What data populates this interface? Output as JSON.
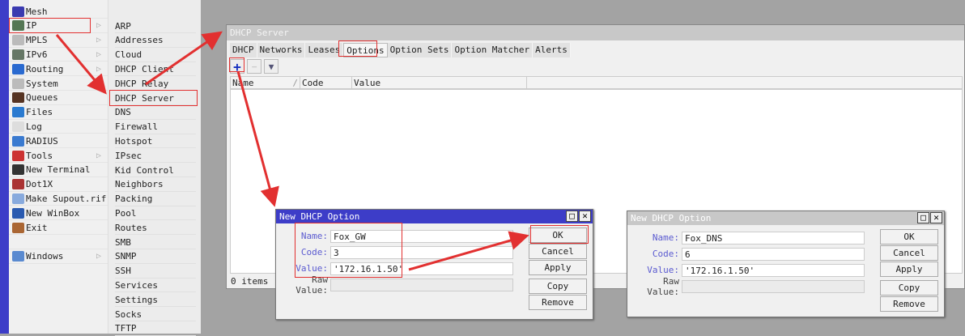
{
  "menu": [
    {
      "label": "Mesh",
      "color": "#3a3ab0",
      "sub": false
    },
    {
      "label": "IP",
      "color": "#557755",
      "sub": true
    },
    {
      "label": "MPLS",
      "color": "#bbbbbb",
      "sub": true
    },
    {
      "label": "IPv6",
      "color": "#667766",
      "sub": true
    },
    {
      "label": "Routing",
      "color": "#2a6ad0",
      "sub": true
    },
    {
      "label": "System",
      "color": "#bbbbbb",
      "sub": true
    },
    {
      "label": "Queues",
      "color": "#553322",
      "sub": false
    },
    {
      "label": "Files",
      "color": "#2a7ad0",
      "sub": false
    },
    {
      "label": "Log",
      "color": "#dddddd",
      "sub": false
    },
    {
      "label": "RADIUS",
      "color": "#3a7ad0",
      "sub": false
    },
    {
      "label": "Tools",
      "color": "#cc3333",
      "sub": true
    },
    {
      "label": "New Terminal",
      "color": "#333333",
      "sub": false
    },
    {
      "label": "Dot1X",
      "color": "#aa3333",
      "sub": false
    },
    {
      "label": "Make Supout.rif",
      "color": "#88aadd",
      "sub": false
    },
    {
      "label": "New WinBox",
      "color": "#2a5ab0",
      "sub": false
    },
    {
      "label": "Exit",
      "color": "#aa6633",
      "sub": false
    },
    {
      "label": "",
      "color": "",
      "sub": false
    },
    {
      "label": "Windows",
      "color": "#5a8ad0",
      "sub": true
    }
  ],
  "ip_submenu": [
    "ARP",
    "Addresses",
    "Cloud",
    "DHCP Client",
    "DHCP Relay",
    "DHCP Server",
    "DNS",
    "Firewall",
    "Hotspot",
    "IPsec",
    "Kid Control",
    "Neighbors",
    "Packing",
    "Pool",
    "Routes",
    "SMB",
    "SNMP",
    "SSH",
    "Services",
    "Settings",
    "Socks",
    "TFTP"
  ],
  "dhcp_window": {
    "title": "DHCP Server",
    "tabs": [
      "DHCP",
      "Networks",
      "Leases",
      "Options",
      "Option Sets",
      "Option Matcher",
      "Alerts"
    ],
    "active_tab": "Options",
    "columns": [
      "Name",
      "Code",
      "Value"
    ],
    "sort_indicator": "/",
    "status": "0 items"
  },
  "dialogs": [
    {
      "title": "New DHCP Option",
      "name_label": "Name:",
      "name": "Fox_GW",
      "code_label": "Code:",
      "code": "3",
      "value_label": "Value:",
      "value": "'172.16.1.50'",
      "raw_label": "Raw Value:",
      "raw": "",
      "buttons": [
        "OK",
        "Cancel",
        "Apply",
        "Copy",
        "Remove"
      ],
      "active": true
    },
    {
      "title": "New DHCP Option",
      "name_label": "Name:",
      "name": "Fox_DNS",
      "code_label": "Code:",
      "code": "6",
      "value_label": "Value:",
      "value": "'172.16.1.50'",
      "raw_label": "Raw Value:",
      "raw": "",
      "buttons": [
        "OK",
        "Cancel",
        "Apply",
        "Copy",
        "Remove"
      ],
      "active": false
    }
  ],
  "colors": {
    "accent": "#3d3dc8",
    "annotation": "#e23030",
    "inactive_title": "#c8c8c8"
  }
}
